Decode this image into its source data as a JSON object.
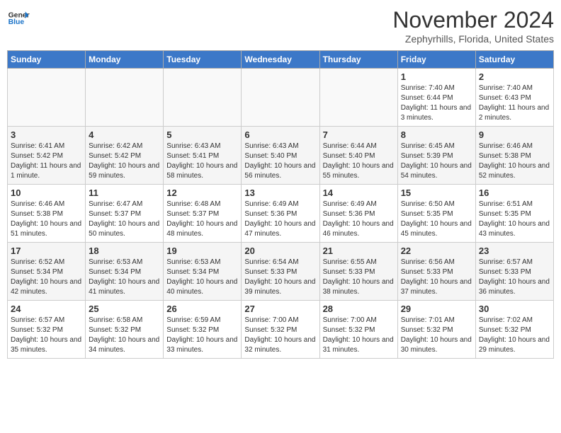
{
  "header": {
    "logo_line1": "General",
    "logo_line2": "Blue",
    "month": "November 2024",
    "location": "Zephyrhills, Florida, United States"
  },
  "days_of_week": [
    "Sunday",
    "Monday",
    "Tuesday",
    "Wednesday",
    "Thursday",
    "Friday",
    "Saturday"
  ],
  "weeks": [
    [
      {
        "day": "",
        "info": ""
      },
      {
        "day": "",
        "info": ""
      },
      {
        "day": "",
        "info": ""
      },
      {
        "day": "",
        "info": ""
      },
      {
        "day": "",
        "info": ""
      },
      {
        "day": "1",
        "info": "Sunrise: 7:40 AM\nSunset: 6:44 PM\nDaylight: 11 hours and 3 minutes."
      },
      {
        "day": "2",
        "info": "Sunrise: 7:40 AM\nSunset: 6:43 PM\nDaylight: 11 hours and 2 minutes."
      }
    ],
    [
      {
        "day": "3",
        "info": "Sunrise: 6:41 AM\nSunset: 5:42 PM\nDaylight: 11 hours and 1 minute."
      },
      {
        "day": "4",
        "info": "Sunrise: 6:42 AM\nSunset: 5:42 PM\nDaylight: 10 hours and 59 minutes."
      },
      {
        "day": "5",
        "info": "Sunrise: 6:43 AM\nSunset: 5:41 PM\nDaylight: 10 hours and 58 minutes."
      },
      {
        "day": "6",
        "info": "Sunrise: 6:43 AM\nSunset: 5:40 PM\nDaylight: 10 hours and 56 minutes."
      },
      {
        "day": "7",
        "info": "Sunrise: 6:44 AM\nSunset: 5:40 PM\nDaylight: 10 hours and 55 minutes."
      },
      {
        "day": "8",
        "info": "Sunrise: 6:45 AM\nSunset: 5:39 PM\nDaylight: 10 hours and 54 minutes."
      },
      {
        "day": "9",
        "info": "Sunrise: 6:46 AM\nSunset: 5:38 PM\nDaylight: 10 hours and 52 minutes."
      }
    ],
    [
      {
        "day": "10",
        "info": "Sunrise: 6:46 AM\nSunset: 5:38 PM\nDaylight: 10 hours and 51 minutes."
      },
      {
        "day": "11",
        "info": "Sunrise: 6:47 AM\nSunset: 5:37 PM\nDaylight: 10 hours and 50 minutes."
      },
      {
        "day": "12",
        "info": "Sunrise: 6:48 AM\nSunset: 5:37 PM\nDaylight: 10 hours and 48 minutes."
      },
      {
        "day": "13",
        "info": "Sunrise: 6:49 AM\nSunset: 5:36 PM\nDaylight: 10 hours and 47 minutes."
      },
      {
        "day": "14",
        "info": "Sunrise: 6:49 AM\nSunset: 5:36 PM\nDaylight: 10 hours and 46 minutes."
      },
      {
        "day": "15",
        "info": "Sunrise: 6:50 AM\nSunset: 5:35 PM\nDaylight: 10 hours and 45 minutes."
      },
      {
        "day": "16",
        "info": "Sunrise: 6:51 AM\nSunset: 5:35 PM\nDaylight: 10 hours and 43 minutes."
      }
    ],
    [
      {
        "day": "17",
        "info": "Sunrise: 6:52 AM\nSunset: 5:34 PM\nDaylight: 10 hours and 42 minutes."
      },
      {
        "day": "18",
        "info": "Sunrise: 6:53 AM\nSunset: 5:34 PM\nDaylight: 10 hours and 41 minutes."
      },
      {
        "day": "19",
        "info": "Sunrise: 6:53 AM\nSunset: 5:34 PM\nDaylight: 10 hours and 40 minutes."
      },
      {
        "day": "20",
        "info": "Sunrise: 6:54 AM\nSunset: 5:33 PM\nDaylight: 10 hours and 39 minutes."
      },
      {
        "day": "21",
        "info": "Sunrise: 6:55 AM\nSunset: 5:33 PM\nDaylight: 10 hours and 38 minutes."
      },
      {
        "day": "22",
        "info": "Sunrise: 6:56 AM\nSunset: 5:33 PM\nDaylight: 10 hours and 37 minutes."
      },
      {
        "day": "23",
        "info": "Sunrise: 6:57 AM\nSunset: 5:33 PM\nDaylight: 10 hours and 36 minutes."
      }
    ],
    [
      {
        "day": "24",
        "info": "Sunrise: 6:57 AM\nSunset: 5:32 PM\nDaylight: 10 hours and 35 minutes."
      },
      {
        "day": "25",
        "info": "Sunrise: 6:58 AM\nSunset: 5:32 PM\nDaylight: 10 hours and 34 minutes."
      },
      {
        "day": "26",
        "info": "Sunrise: 6:59 AM\nSunset: 5:32 PM\nDaylight: 10 hours and 33 minutes."
      },
      {
        "day": "27",
        "info": "Sunrise: 7:00 AM\nSunset: 5:32 PM\nDaylight: 10 hours and 32 minutes."
      },
      {
        "day": "28",
        "info": "Sunrise: 7:00 AM\nSunset: 5:32 PM\nDaylight: 10 hours and 31 minutes."
      },
      {
        "day": "29",
        "info": "Sunrise: 7:01 AM\nSunset: 5:32 PM\nDaylight: 10 hours and 30 minutes."
      },
      {
        "day": "30",
        "info": "Sunrise: 7:02 AM\nSunset: 5:32 PM\nDaylight: 10 hours and 29 minutes."
      }
    ]
  ]
}
